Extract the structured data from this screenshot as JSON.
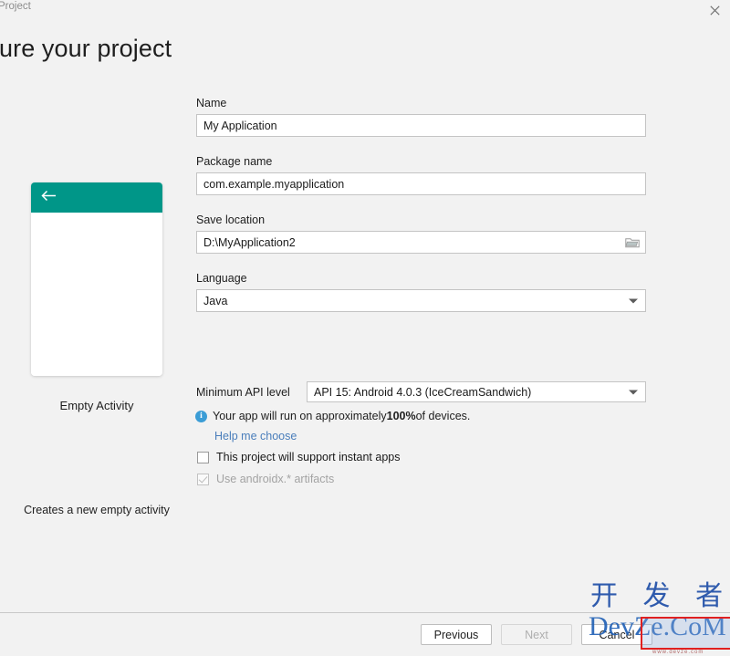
{
  "window": {
    "title": "Project",
    "close_icon": "close-icon"
  },
  "heading": "ure your project",
  "preview": {
    "title": "Empty Activity",
    "description": "Creates a new empty activity",
    "appbar_icon": "back-arrow-icon",
    "appbar_color": "#009688"
  },
  "form": {
    "name": {
      "label": "Name",
      "value": "My Application"
    },
    "package_name": {
      "label": "Package name",
      "value": "com.example.myapplication"
    },
    "save_location": {
      "label": "Save location",
      "value": "D:\\MyApplication2",
      "browse_icon": "folder-icon"
    },
    "language": {
      "label": "Language",
      "value": "Java"
    },
    "minimum_api": {
      "label": "Minimum API level",
      "value": "API 15: Android 4.0.3 (IceCreamSandwich)"
    },
    "info": {
      "icon": "info-icon",
      "text_before": "Your app will run on approximately ",
      "percent": "100%",
      "text_after": " of devices.",
      "link": "Help me choose",
      "link_color": "#4a7ebb"
    },
    "instant_apps_checkbox": {
      "label": "This project will support instant apps",
      "checked": false
    },
    "androidx_checkbox": {
      "label": "Use androidx.* artifacts",
      "checked": true,
      "disabled": true
    }
  },
  "footer": {
    "previous": "Previous",
    "next": "Next",
    "cancel": "Cancel"
  },
  "watermark": {
    "cn": "开 发 者",
    "en": "DevZe.CoM",
    "sub": "www.devze.com"
  }
}
